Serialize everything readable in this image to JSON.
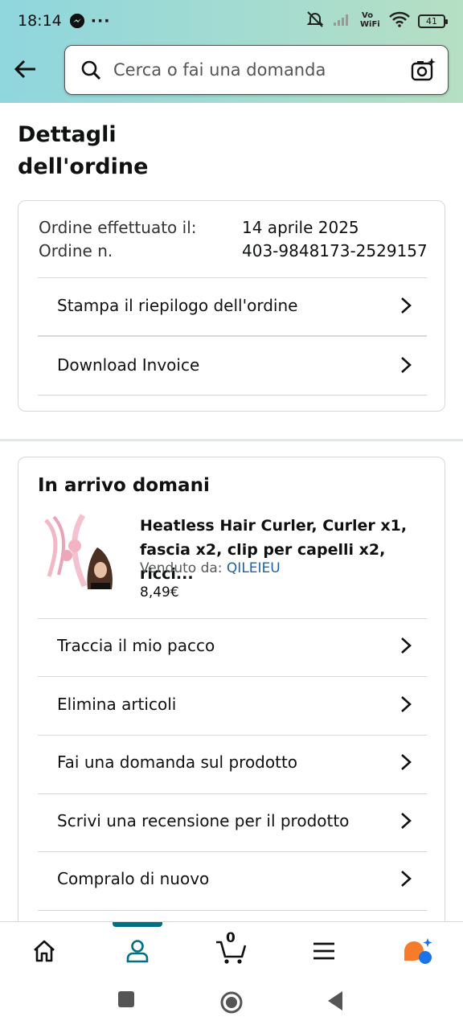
{
  "status_bar": {
    "time": "18:14",
    "dots": "···",
    "battery": "41",
    "icons": [
      "messenger-icon",
      "mute-icon",
      "signal-icon",
      "vowifi-icon",
      "wifi-icon",
      "battery-icon"
    ]
  },
  "header": {
    "search_placeholder": "Cerca o fai una domanda"
  },
  "page_title_line1": "Dettagli",
  "page_title_line2": "dell'ordine",
  "order_info": {
    "date_label": "Ordine effettuato il:",
    "date_value": "14 aprile 2025",
    "number_label": "Ordine n.",
    "number_value": "403-9848173-2529157"
  },
  "order_actions": [
    {
      "label": "Stampa il riepilogo dell'ordine"
    },
    {
      "label": "Download Invoice"
    }
  ],
  "shipment": {
    "heading": "In arrivo domani",
    "product": {
      "title_line1": "Heatless Hair Curler, Curler x1,",
      "title_line2": "fascia x2, clip per capelli x2, ricci...",
      "seller_label": "Venduto da:",
      "seller_name": "QILEIEU",
      "price": "8,49€"
    },
    "actions": [
      {
        "label": "Traccia il mio pacco"
      },
      {
        "label": "Elimina articoli"
      },
      {
        "label": "Fai una domanda sul prodotto"
      },
      {
        "label": "Scrivi una recensione per il prodotto"
      },
      {
        "label": "Compralo di nuovo"
      }
    ]
  },
  "bottom_nav": {
    "cart_count": "0",
    "active_tab": "account",
    "accent_color": "#007185"
  }
}
